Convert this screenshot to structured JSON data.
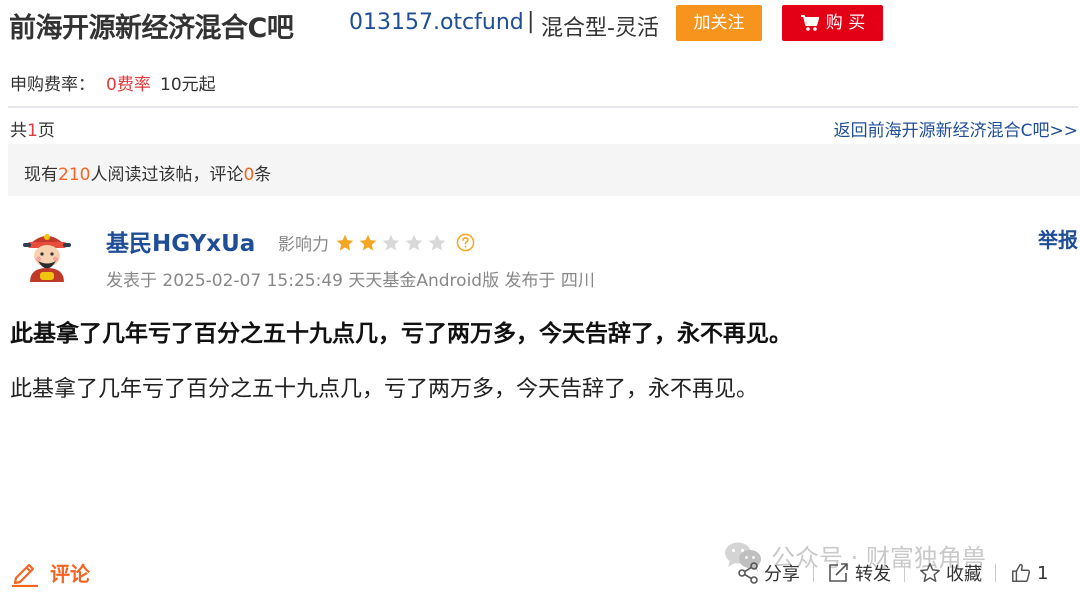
{
  "header": {
    "title": "前海开源新经济混合C吧",
    "fund_code": "013157.otcfund",
    "separator": "|",
    "fund_type": "混合型-灵活",
    "follow_label": "加关注",
    "buy_label": "购 买"
  },
  "fee": {
    "label": "申购费率：",
    "rate": "0费率",
    "minimum": "10元起"
  },
  "pager": {
    "prefix": "共",
    "count": "1",
    "suffix": "页",
    "back_link": "返回前海开源新经济混合C吧>>"
  },
  "stats": {
    "prefix": "现有",
    "readers": "210",
    "middle": "人阅读过该帖，评论",
    "comments": "0",
    "suffix": "条"
  },
  "post": {
    "username": "基民HGYxUa",
    "influence_label": "影响力",
    "rating": 2,
    "rating_max": 5,
    "report_label": "举报",
    "meta": "发表于 2025-02-07 15:25:49 天天基金Android版 发布于 四川",
    "title": "此基拿了几年亏了百分之五十九点几，亏了两万多，今天告辞了，永不再见。",
    "body": "此基拿了几年亏了百分之五十九点几，亏了两万多，今天告辞了，永不再见。"
  },
  "footer": {
    "comment_label": "评论",
    "watermark": "公众号 · 财富独角兽",
    "share_label": "分享",
    "repost_label": "转发",
    "favorite_label": "收藏",
    "like_count": "1"
  },
  "colors": {
    "brand_blue": "#1f4e97",
    "follow_orange": "#f7941d",
    "buy_red": "#e30016",
    "highlight_orange": "#f26522",
    "star_gold": "#f5a623",
    "star_gray": "#d9d9d9"
  },
  "icons": {
    "buy": "cart-icon",
    "help": "question-circle-icon",
    "comment": "pencil-icon",
    "watermark": "wechat-icon",
    "share": "share-icon",
    "repost": "repost-icon",
    "favorite": "star-outline-icon",
    "like": "thumbs-up-icon"
  }
}
